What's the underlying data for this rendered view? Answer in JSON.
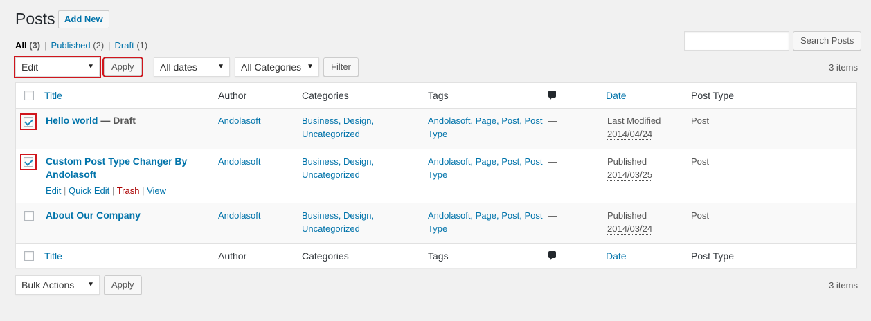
{
  "header": {
    "title": "Posts",
    "add_new": "Add New"
  },
  "views": [
    {
      "label": "All",
      "count": "(3)"
    },
    {
      "label": "Published",
      "count": "(2)"
    },
    {
      "label": "Draft",
      "count": "(1)"
    }
  ],
  "views_sep": "|",
  "search": {
    "placeholder": "",
    "button": "Search Posts"
  },
  "top_nav": {
    "bulk_action": "Edit",
    "apply": "Apply",
    "dates": "All dates",
    "categories": "All Categories",
    "filter": "Filter",
    "items": "3 items"
  },
  "bottom_nav": {
    "bulk_action": "Bulk Actions",
    "apply": "Apply",
    "items": "3 items"
  },
  "columns": {
    "title": "Title",
    "author": "Author",
    "categories": "Categories",
    "tags": "Tags",
    "date": "Date",
    "post_type": "Post Type"
  },
  "rows": [
    {
      "title": "Hello world",
      "state": " — Draft",
      "author": "Andolasoft",
      "categories_1": "Business, Design,",
      "categories_2": "Uncategorized",
      "tags_1": "Andolasoft, Page, Post, Post",
      "tags_2": "Type",
      "comments": "—",
      "date_status": "Last Modified",
      "date": "2014/04/24",
      "post_type": "Post",
      "checked": true
    },
    {
      "title_1": "Custom Post Type Changer By",
      "title_2": "Andolasoft",
      "author": "Andolasoft",
      "categories_1": "Business, Design,",
      "categories_2": "Uncategorized",
      "tags_1": "Andolasoft, Page, Post, Post",
      "tags_2": "Type",
      "comments": "—",
      "date_status": "Published",
      "date": "2014/03/25",
      "post_type": "Post",
      "checked": true,
      "actions": {
        "edit": "Edit",
        "quick_edit": "Quick Edit",
        "trash": "Trash",
        "view": "View",
        "sep": "|"
      }
    },
    {
      "title": "About Our Company",
      "author": "Andolasoft",
      "categories_1": "Business, Design,",
      "categories_2": "Uncategorized",
      "tags_1": "Andolasoft, Page, Post, Post",
      "tags_2": "Type",
      "comments": "—",
      "date_status": "Published",
      "date": "2014/03/24",
      "post_type": "Post",
      "checked": false
    }
  ],
  "icons": {
    "dropdown_arrow": "triangle-down-icon",
    "comments_column": "comment-bubble-icon",
    "checkmark": "checkmark-icon"
  },
  "colors": {
    "link": "#0073aa",
    "highlight": "#d0161d",
    "trash": "#a00"
  }
}
